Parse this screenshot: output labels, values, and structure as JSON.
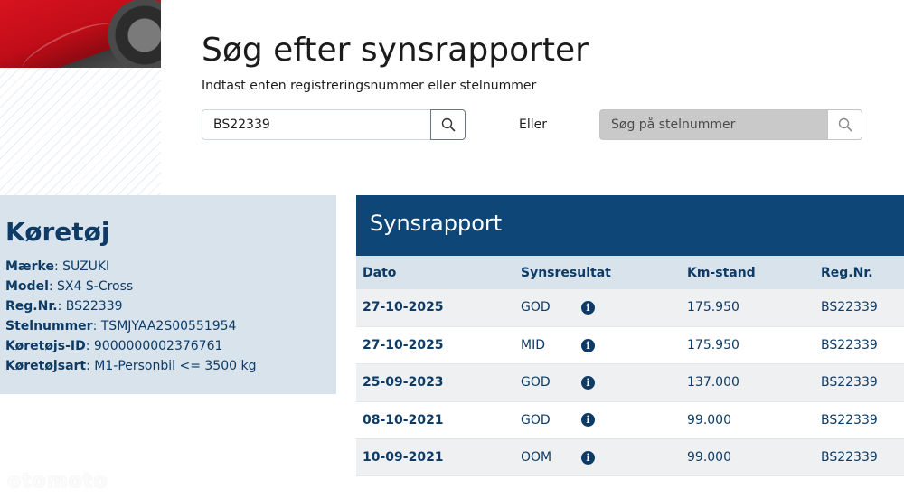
{
  "search": {
    "title": "Søg efter synsrapporter",
    "subtitle": "Indtast enten registreringsnummer eller stelnummer",
    "reg_value": "BS22339",
    "or_label": "Eller",
    "vin_placeholder": "Søg på stelnummer",
    "icons": {
      "reg_search": "search-icon",
      "vin_search": "search-icon"
    }
  },
  "vehicle": {
    "title": "Køretøj",
    "fields": [
      {
        "label": "Mærke",
        "value": "SUZUKI"
      },
      {
        "label": "Model",
        "value": "SX4 S-Cross"
      },
      {
        "label": "Reg.Nr.",
        "value": "BS22339"
      },
      {
        "label": "Stelnummer",
        "value": "TSMJYAA2S00551954"
      },
      {
        "label": "Køretøjs-ID",
        "value": "9000000002376761"
      },
      {
        "label": "Køretøjsart",
        "value": "M1-Personbil <= 3500 kg"
      }
    ]
  },
  "report": {
    "title": "Synsrapport",
    "columns": [
      "Dato",
      "Synsresultat",
      "Km-stand",
      "Reg.Nr."
    ],
    "rows": [
      {
        "date": "27-10-2025",
        "result": "GOD",
        "km": "175.950",
        "reg": "BS22339"
      },
      {
        "date": "27-10-2025",
        "result": "MID",
        "km": "175.950",
        "reg": "BS22339"
      },
      {
        "date": "25-09-2023",
        "result": "GOD",
        "km": "137.000",
        "reg": "BS22339"
      },
      {
        "date": "08-10-2021",
        "result": "GOD",
        "km": "99.000",
        "reg": "BS22339"
      },
      {
        "date": "10-09-2021",
        "result": "OOM",
        "km": "99.000",
        "reg": "BS22339"
      }
    ],
    "info_icon": "info-icon",
    "info_glyph": "i"
  },
  "watermark": "otomoto",
  "colors": {
    "primary": "#0d4677",
    "panel": "#d8e3ec",
    "text_blue": "#0d3b66"
  }
}
